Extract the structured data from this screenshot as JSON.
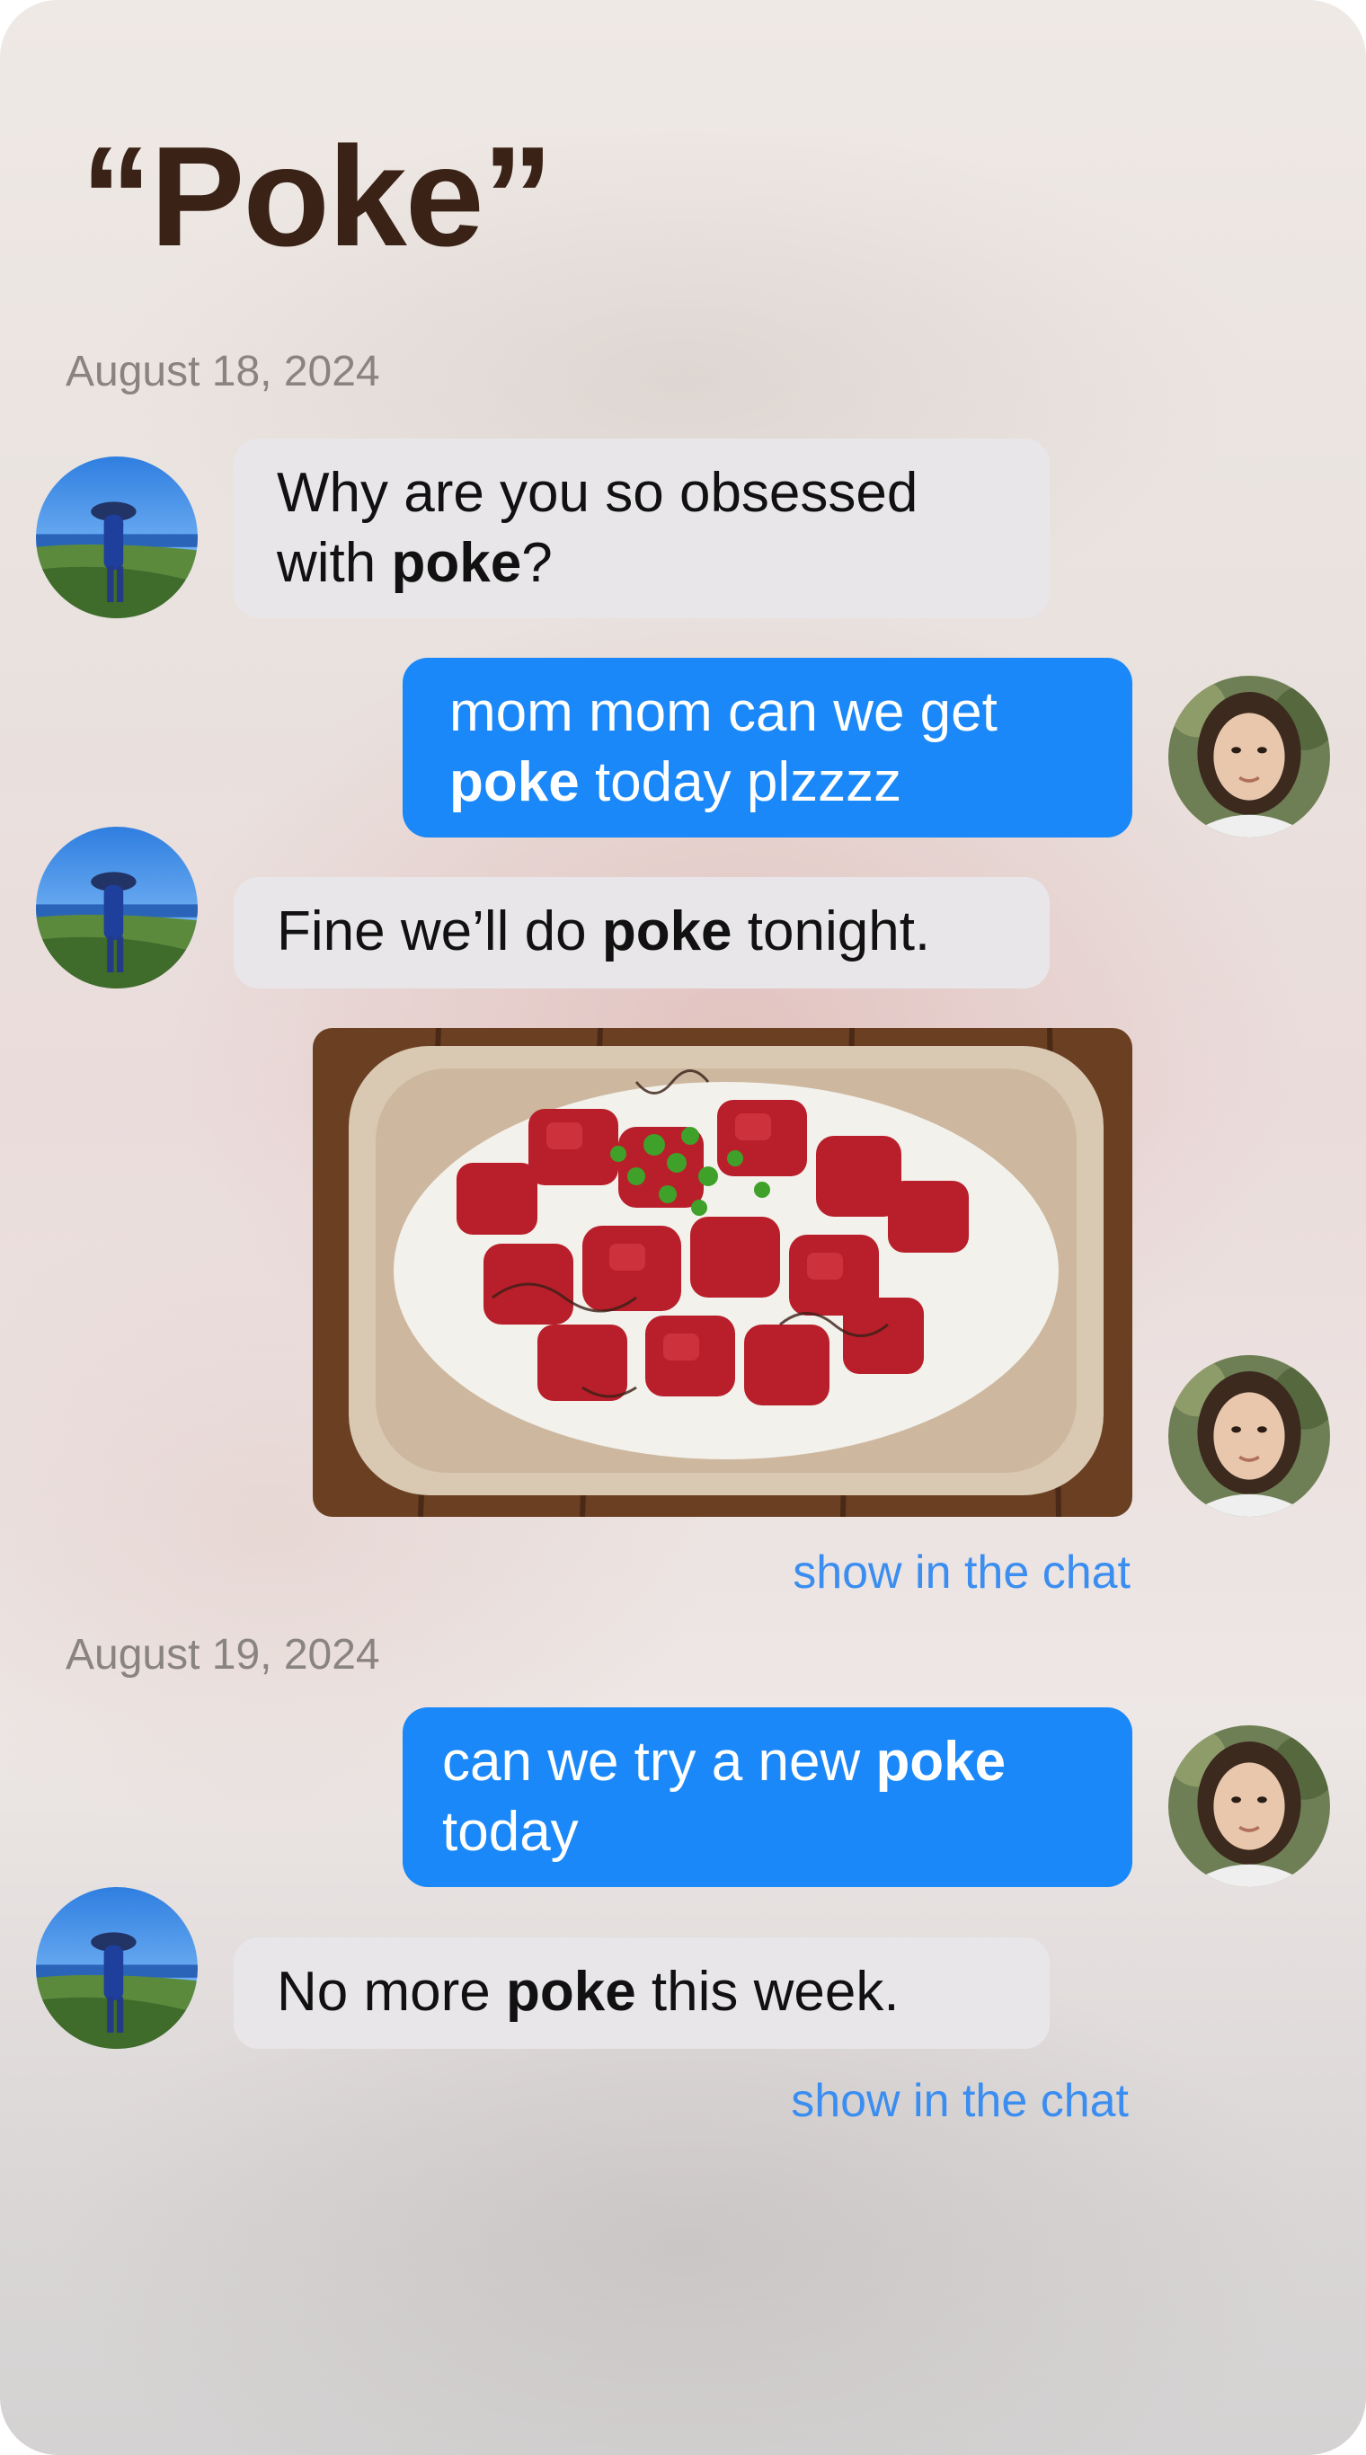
{
  "header": {
    "title": "“Poke”"
  },
  "groups": [
    {
      "date": "August 18, 2024"
    },
    {
      "date": "August 19, 2024"
    }
  ],
  "messages": [
    {
      "pre": "Why are you so obsessed with ",
      "keyword": "poke",
      "post": "?"
    },
    {
      "pre": "mom mom can we get ",
      "keyword": "poke",
      "post": " today plzzzz"
    },
    {
      "pre": "Fine we’ll do ",
      "keyword": "poke",
      "post": " tonight."
    },
    {
      "pre": "can we try a new ",
      "keyword": "poke",
      "post": " today"
    },
    {
      "pre": "No more ",
      "keyword": "poke",
      "post": " this week."
    }
  ],
  "links": {
    "show_in_chat": "show in the chat"
  },
  "images": {
    "poke_bowl": "poke-bowl-photo"
  },
  "colors": {
    "outgoing_bubble": "#1a88f8",
    "incoming_bubble": "#e8e6e9",
    "link": "#3b8ef0",
    "title": "#3a2216",
    "date": "#8a8480"
  }
}
